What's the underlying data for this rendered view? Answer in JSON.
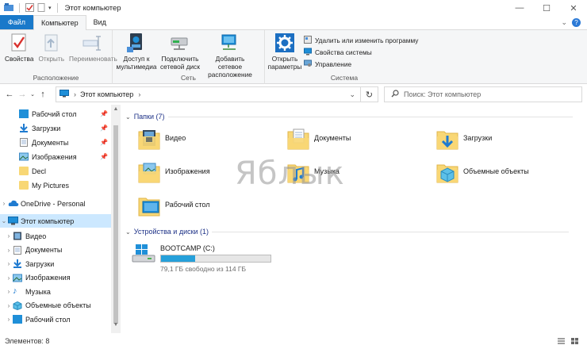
{
  "window": {
    "title": "Этот компьютер",
    "controls": [
      "minimize",
      "maximize",
      "close"
    ]
  },
  "ribbon": {
    "tabs": [
      {
        "label": "Файл",
        "active": false
      },
      {
        "label": "Компьютер",
        "active": true
      },
      {
        "label": "Вид",
        "active": false
      }
    ],
    "groups": [
      {
        "label": "Расположение",
        "buttons": [
          {
            "label": "Свойства",
            "icon": "check-properties-icon",
            "enabled": true
          },
          {
            "label": "Открыть",
            "icon": "open-icon",
            "enabled": false
          },
          {
            "label": "Переименовать",
            "icon": "rename-icon",
            "enabled": false
          }
        ]
      },
      {
        "label": "Сеть",
        "buttons": [
          {
            "label": "Доступ к мультимедиа",
            "icon": "media-access-icon",
            "dropdown": true
          },
          {
            "label": "Подключить сетевой диск",
            "icon": "map-network-drive-icon",
            "dropdown": true
          },
          {
            "label": "Добавить сетевое расположение",
            "icon": "add-network-location-icon"
          }
        ]
      },
      {
        "label": "Система",
        "buttons": [
          {
            "label": "Открыть параметры",
            "icon": "settings-gear-icon"
          }
        ],
        "small_buttons": [
          {
            "label": "Удалить или изменить программу",
            "icon": "uninstall-program-icon"
          },
          {
            "label": "Свойства системы",
            "icon": "system-properties-icon"
          },
          {
            "label": "Управление",
            "icon": "manage-icon"
          }
        ]
      }
    ]
  },
  "address_bar": {
    "path": "Этот компьютер",
    "search_placeholder": "Поиск: Этот компьютер"
  },
  "nav_pane": {
    "quick_access": [
      {
        "label": "Рабочий стол",
        "icon": "desktop-folder-icon",
        "pinned": true
      },
      {
        "label": "Загрузки",
        "icon": "downloads-folder-icon",
        "pinned": true
      },
      {
        "label": "Документы",
        "icon": "documents-folder-icon",
        "pinned": true
      },
      {
        "label": "Изображения",
        "icon": "pictures-folder-icon",
        "pinned": true
      },
      {
        "label": "Decl",
        "icon": "folder-icon",
        "pinned": false
      },
      {
        "label": "My Pictures",
        "icon": "folder-icon",
        "pinned": false
      }
    ],
    "onedrive": {
      "label": "OneDrive - Personal",
      "icon": "onedrive-cloud-icon"
    },
    "this_pc": {
      "label": "Этот компьютер",
      "icon": "computer-icon",
      "selected": true
    },
    "this_pc_children": [
      {
        "label": "Видео",
        "icon": "video-folder-icon"
      },
      {
        "label": "Документы",
        "icon": "documents-folder-icon"
      },
      {
        "label": "Загрузки",
        "icon": "downloads-folder-icon"
      },
      {
        "label": "Изображения",
        "icon": "pictures-folder-icon"
      },
      {
        "label": "Музыка",
        "icon": "music-folder-icon"
      },
      {
        "label": "Объемные объекты",
        "icon": "3d-objects-folder-icon"
      },
      {
        "label": "Рабочий стол",
        "icon": "desktop-folder-icon"
      }
    ]
  },
  "content": {
    "folders_header": "Папки (7)",
    "folders": [
      {
        "label": "Видео",
        "icon": "video-folder-icon"
      },
      {
        "label": "Документы",
        "icon": "documents-folder-icon"
      },
      {
        "label": "Загрузки",
        "icon": "downloads-folder-icon"
      },
      {
        "label": "Изображения",
        "icon": "pictures-folder-icon"
      },
      {
        "label": "Музыка",
        "icon": "music-folder-icon"
      },
      {
        "label": "Объемные объекты",
        "icon": "3d-objects-folder-icon"
      },
      {
        "label": "Рабочий стол",
        "icon": "desktop-folder-icon"
      }
    ],
    "drives_header": "Устройства и диски (1)",
    "drives": [
      {
        "label": "BOOTCAMP (C:)",
        "free_text": "79,1 ГБ свободно из 114 ГБ",
        "used_fraction": 0.31,
        "icon": "windows-drive-icon"
      }
    ]
  },
  "watermark": "Яблык",
  "status_bar": {
    "items_text": "Элементов: 8"
  },
  "colors": {
    "accent": "#1979ca",
    "selection": "#cce8ff",
    "drive_bar": "#26a0da",
    "folder_yellow": "#f8d775"
  }
}
